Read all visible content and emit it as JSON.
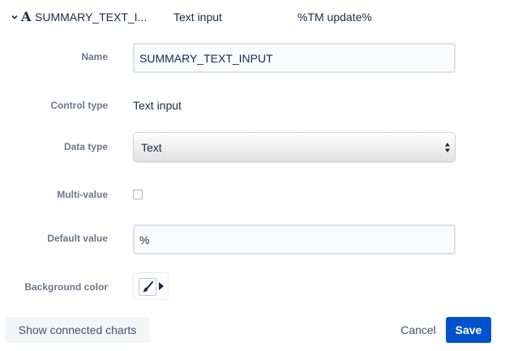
{
  "header": {
    "collapse_icon": "chevron-down-icon",
    "type_icon_glyph": "A",
    "name_label": "SUMMARY_TEXT_I...",
    "control_type": "Text input",
    "default_value": "%TM update%"
  },
  "form": {
    "name": {
      "label": "Name",
      "value": "SUMMARY_TEXT_INPUT"
    },
    "control_type": {
      "label": "Control type",
      "value": "Text input"
    },
    "data_type": {
      "label": "Data type",
      "selected": "Text"
    },
    "multi_value": {
      "label": "Multi-value",
      "checked": false
    },
    "default_value": {
      "label": "Default value",
      "value": "%"
    },
    "background_color": {
      "label": "Background color",
      "icon": "paint-brush-icon"
    }
  },
  "footer": {
    "connected_label": "Show connected charts",
    "cancel_label": "Cancel",
    "save_label": "Save"
  },
  "colors": {
    "primary": "#0052cc",
    "label_gray": "#6b778c",
    "text": "#172b4d"
  }
}
